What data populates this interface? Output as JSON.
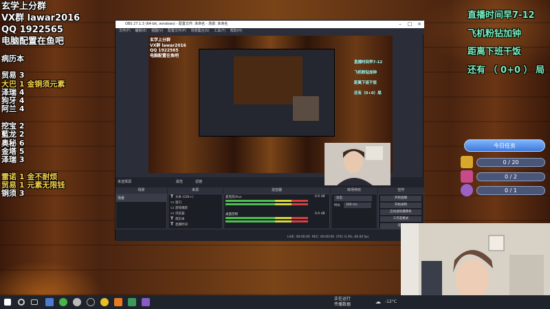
{
  "overlay_left": {
    "lines": [
      "玄学上分群",
      "VX群 lawar2016",
      "QQ 1922565",
      "电脑配置在鱼吧"
    ],
    "medical_title": "病历本",
    "records": [
      {
        "text": "贸易 3",
        "highlight": false
      },
      {
        "text": "大巴 1 金铜须元素",
        "highlight": true
      },
      {
        "text": "泽瑞 4",
        "highlight": false
      },
      {
        "text": "狗牙 4",
        "highlight": false
      },
      {
        "text": "阿兰 4",
        "highlight": false
      },
      {
        "text": "",
        "highlight": false
      },
      {
        "text": "挖宝 2",
        "highlight": false
      },
      {
        "text": "藍龙 2",
        "highlight": false
      },
      {
        "text": "奥秘 6",
        "highlight": false
      },
      {
        "text": "金塔 5",
        "highlight": false
      },
      {
        "text": "泽瑞 3",
        "highlight": false
      },
      {
        "text": "",
        "highlight": false
      },
      {
        "text": "雷诺 1 金不耐烦",
        "highlight": true
      },
      {
        "text": "贸易 1 元素无限钱",
        "highlight": true
      },
      {
        "text": "铜须 3",
        "highlight": false
      }
    ]
  },
  "overlay_right": {
    "lines": [
      "直播时间早7-12",
      "飞机粉钻加钟",
      "距离下班干饭",
      "还有 （ 0+0 ） 局"
    ],
    "tasks_title": "今日任务",
    "tasks": [
      {
        "value": "0 / 20",
        "color": "#d9a82a"
      },
      {
        "value": "0 / 2",
        "color": "#c84a8a"
      },
      {
        "value": "0 / 1",
        "color": "#9a62c8"
      }
    ]
  },
  "obs": {
    "title": "OBS 27.1.3 (64-bit, windows) - 配置文件: 未命名 - 场景: 未命名",
    "menu": [
      "文件(F)",
      "编辑(E)",
      "视图(V)",
      "配置文件(P)",
      "场景集合(S)",
      "工具(T)",
      "帮助(H)"
    ],
    "preview_lines": [
      "玄学上分群",
      "VX群 lawar2016",
      "QQ 1922565",
      "电脑配置在鱼吧"
    ],
    "preview_right": [
      "直播时间早7-12",
      "飞机粉钻加钟",
      "距离下班干饭",
      "还有（0+0）局"
    ],
    "no_source_selected": "未选择源",
    "properties_btn": "属性",
    "filters_btn": "滤镜",
    "panels": [
      "场景",
      "来源",
      "混音器",
      "转场特效",
      "控件"
    ],
    "scene_item": "场景",
    "sources": [
      "文本 (GDI+)",
      "窗口",
      "游戏捕获",
      "浏览器",
      "病历本",
      "直播时间"
    ],
    "mixer": [
      {
        "name": "麦克风/Aux",
        "db": "0.0 dB"
      },
      {
        "name": "桌面音频",
        "db": "0.0 dB"
      }
    ],
    "transition": {
      "label": "淡出",
      "duration_label": "时长",
      "duration": "300 ms"
    },
    "controls": [
      "开始直播",
      "开始录制",
      "启动虚拟摄像机",
      "工作室模式",
      "设置",
      "退出"
    ],
    "status": [
      "LIVE: 00:00:00",
      "REC: 00:00:00",
      "CPU: 0.3%, 60.00 fps"
    ]
  },
  "taskbar": {
    "tray": [
      "正在运行",
      "传播数据"
    ],
    "temp": "-12°C",
    "time": "",
    "icons": [
      "start-icon",
      "search-icon",
      "taskview-icon",
      "app-icon",
      "chat-icon",
      "obs-icon",
      "browser-icon",
      "game-icon",
      "folder-icon",
      "media-icon"
    ]
  }
}
